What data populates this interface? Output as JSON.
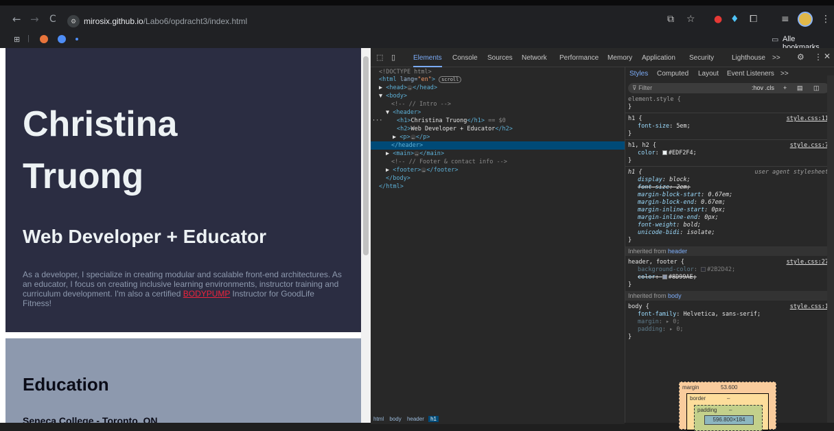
{
  "browser": {
    "nav": {
      "back": "←",
      "forward": "→",
      "reload": "C"
    },
    "url": {
      "host": "mirosix.github.io",
      "path": "/Labo6/opdracht3/index.html"
    },
    "bookmarks_label": "Alle bookmarks"
  },
  "page": {
    "h1": "Christina Truong",
    "h2": "Web Developer + Educator",
    "intro_text": "As a developer, I specialize in creating modular and scalable front-end architectures. As an educator, I focus on creating inclusive learning environments, instructor training and curriculum development. I'm also a certified",
    "intro_link": "BODYPUMP",
    "intro_tail": "Instructor for GoodLife Fitness!",
    "education_heading": "Education",
    "education_sub": "Seneca College - Toronto, ON"
  },
  "devtools": {
    "tabs": [
      "Elements",
      "Console",
      "Sources",
      "Network",
      "Performance",
      "Memory",
      "Application",
      "Security",
      "Lighthouse"
    ],
    "overflow": ">>",
    "dom": {
      "doctype": "<!DOCTYPE html>",
      "html_open": "html",
      "lang_attr": "lang",
      "lang_val": "\"en\"",
      "scroll_badge": "scroll",
      "head": "head",
      "body": "body",
      "comment_intro": "<!-- // Intro -->",
      "header": "header",
      "h1_text": "Christina Truong",
      "sel_marker": "== $0",
      "h2_text": "Web Developer + Educator",
      "p": "p",
      "main": "main",
      "comment_footer": "<!-- // Footer & contact info -->",
      "footer": "footer",
      "close_body": "</body>",
      "close_html": "</html>"
    },
    "breadcrumbs": [
      "html",
      "body",
      "header",
      "h1"
    ],
    "styles": {
      "tabs": [
        "Styles",
        "Computed",
        "Layout",
        "Event Listeners"
      ],
      "filter_placeholder": "Filter",
      "filter_tools": ":hov .cls",
      "element_style": "element.style {",
      "close": "}",
      "rule1": {
        "sel": "h1 {",
        "src": "style.css:11",
        "prop": "font-size",
        "val": "5em;"
      },
      "rule2": {
        "sel": "h1, h2 {",
        "src": "style.css:7",
        "prop": "color",
        "val": "#EDF2F4;",
        "swatch": "#EDF2F4"
      },
      "rule3": {
        "sel": "h1 {",
        "src": "user agent stylesheet",
        "props": [
          [
            "display",
            "block;"
          ],
          [
            "font-size",
            "2em;"
          ],
          [
            "margin-block-start",
            "0.67em;"
          ],
          [
            "margin-block-end",
            "0.67em;"
          ],
          [
            "margin-inline-start",
            "0px;"
          ],
          [
            "margin-inline-end",
            "0px;"
          ],
          [
            "font-weight",
            "bold;"
          ],
          [
            "unicode-bidi",
            "isolate;"
          ]
        ]
      },
      "inherited_header": {
        "label": "Inherited from",
        "tag": "header"
      },
      "rule4": {
        "sel": "header, footer {",
        "src": "style.css:27",
        "p1": "background-color",
        "v1": "#2B2D42;",
        "sw1": "#2B2D42",
        "p2": "color",
        "v2": "#8D99AE;",
        "sw2": "#8D99AE"
      },
      "inherited_body": {
        "label": "Inherited from",
        "tag": "body"
      },
      "rule5": {
        "sel": "body {",
        "src": "style.css:1",
        "p1": "font-family",
        "v1": "Helvetica, sans-serif;",
        "p2": "margin",
        "v2": "▸ 0;",
        "p3": "padding",
        "v3": "▸ 0;"
      },
      "boxmodel": {
        "margin_label": "margin",
        "margin_val": "53.600",
        "border_label": "border",
        "border_val": "–",
        "padding_label": "padding",
        "padding_val": "–",
        "content": "596.800×184",
        "dash": "–"
      }
    }
  },
  "colors": {
    "header_bg": "#2B2D42",
    "header_text": "#EDF2F4",
    "muted": "#8D99AE",
    "link": "#ef233c"
  }
}
